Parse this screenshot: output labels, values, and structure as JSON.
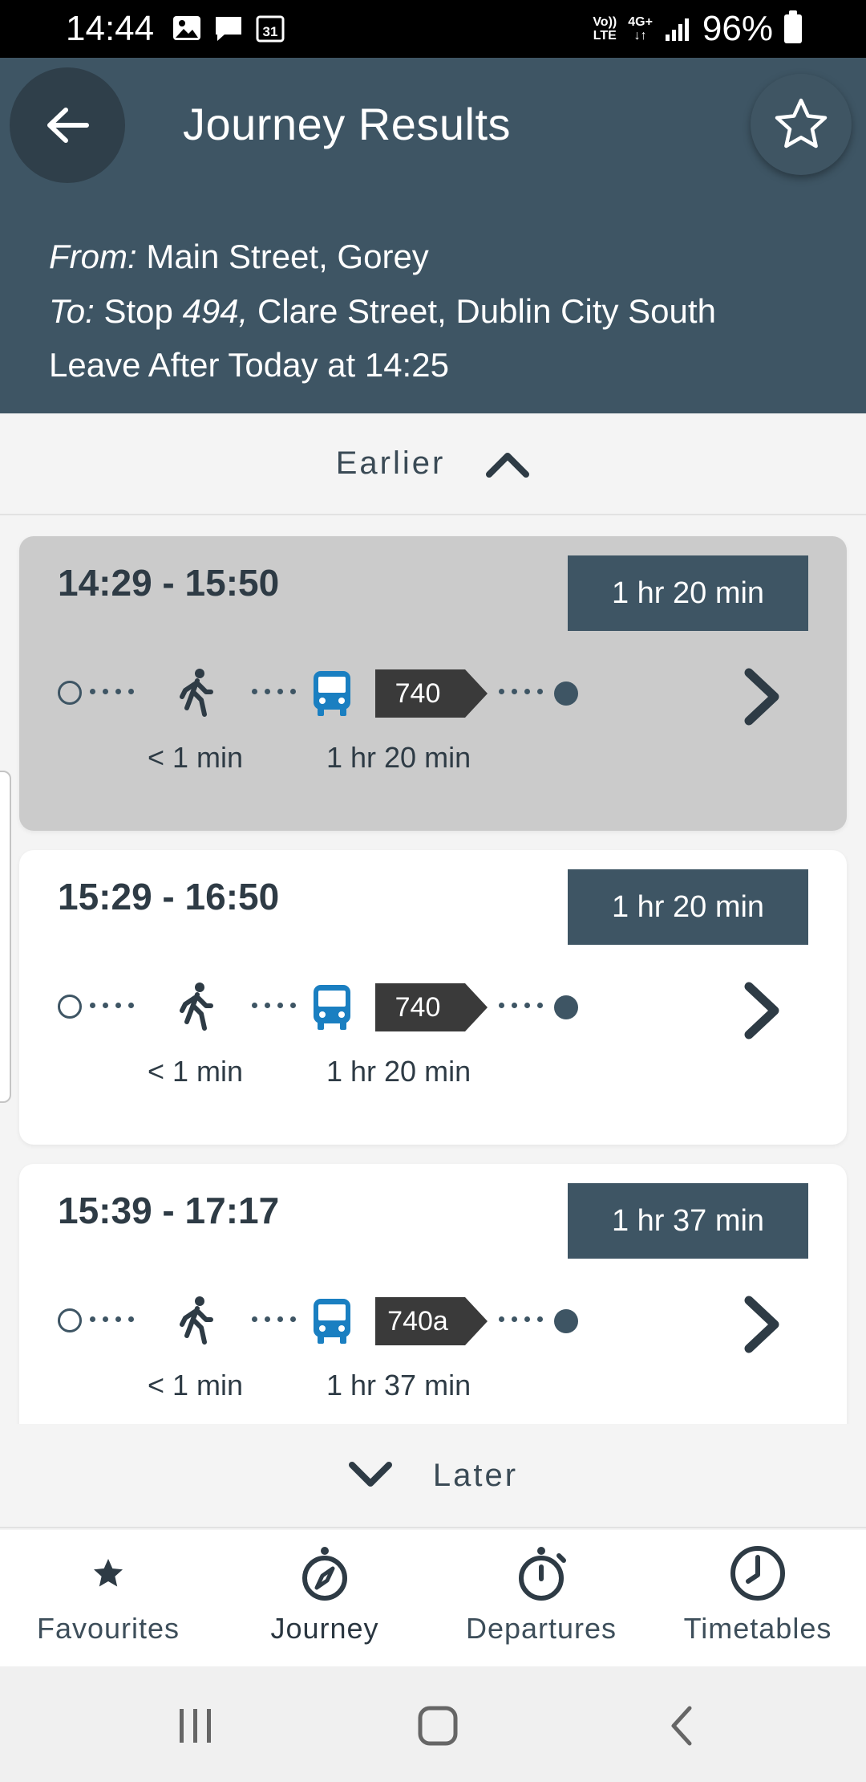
{
  "status_bar": {
    "time": "14:44",
    "lte_top": "Vo))",
    "lte_bottom": "LTE",
    "net_type": "4G+",
    "battery": "96%",
    "calendar_day": "31"
  },
  "header": {
    "title": "Journey Results",
    "from_label": "From:",
    "from_value": "Main Street, Gorey",
    "to_label": "To:",
    "to_stop_prefix": "Stop",
    "to_stop_number": "494,",
    "to_value": "Clare Street, Dublin City South",
    "leave_text": "Leave After Today at 14:25"
  },
  "earlier_label": "Earlier",
  "later_label": "Later",
  "journeys": [
    {
      "time_range": "14:29 - 15:50",
      "duration": "1 hr 20 min",
      "route": "740",
      "walk_time": "< 1 min",
      "bus_time": "1 hr 20 min",
      "selected": true
    },
    {
      "time_range": "15:29 - 16:50",
      "duration": "1 hr 20 min",
      "route": "740",
      "walk_time": "< 1 min",
      "bus_time": "1 hr 20 min",
      "selected": false
    },
    {
      "time_range": "15:39 - 17:17",
      "duration": "1 hr 37 min",
      "route": "740a",
      "walk_time": "< 1 min",
      "bus_time": "1 hr 37 min",
      "selected": false
    }
  ],
  "bottom_nav": [
    {
      "label": "Favourites",
      "icon": "star-icon"
    },
    {
      "label": "Journey",
      "icon": "compass-icon",
      "active": true
    },
    {
      "label": "Departures",
      "icon": "stopwatch-icon"
    },
    {
      "label": "Timetables",
      "icon": "clock-icon"
    }
  ],
  "colors": {
    "header_bg": "#3e5564",
    "badge_bg": "#3e5564",
    "bus_blue": "#1a7fc1",
    "route_tag_bg": "#3a3a3a",
    "selected_card_bg": "#cbcbcb"
  }
}
